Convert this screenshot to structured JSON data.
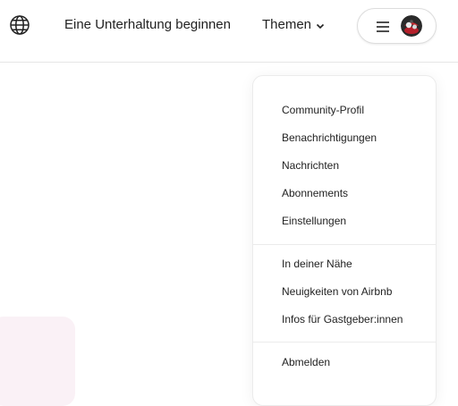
{
  "header": {
    "start_conversation": "Eine Unterhaltung beginnen",
    "topics_label": "Themen"
  },
  "user_menu": {
    "group1": [
      "Community-Profil",
      "Benachrichtigungen",
      "Nachrichten",
      "Abonnements",
      "Einstellungen"
    ],
    "group2": [
      "In deiner Nähe",
      "Neuigkeiten von Airbnb",
      "Infos für Gastgeber:innen"
    ],
    "group3": [
      "Abmelden"
    ]
  },
  "icons": {
    "language": "globe-icon",
    "topics_chevron": "chevron-down-icon",
    "menu": "hamburger-menu-icon"
  },
  "colors": {
    "text": "#222222",
    "border": "#dddddd",
    "card_tint": "#faf1f6"
  }
}
